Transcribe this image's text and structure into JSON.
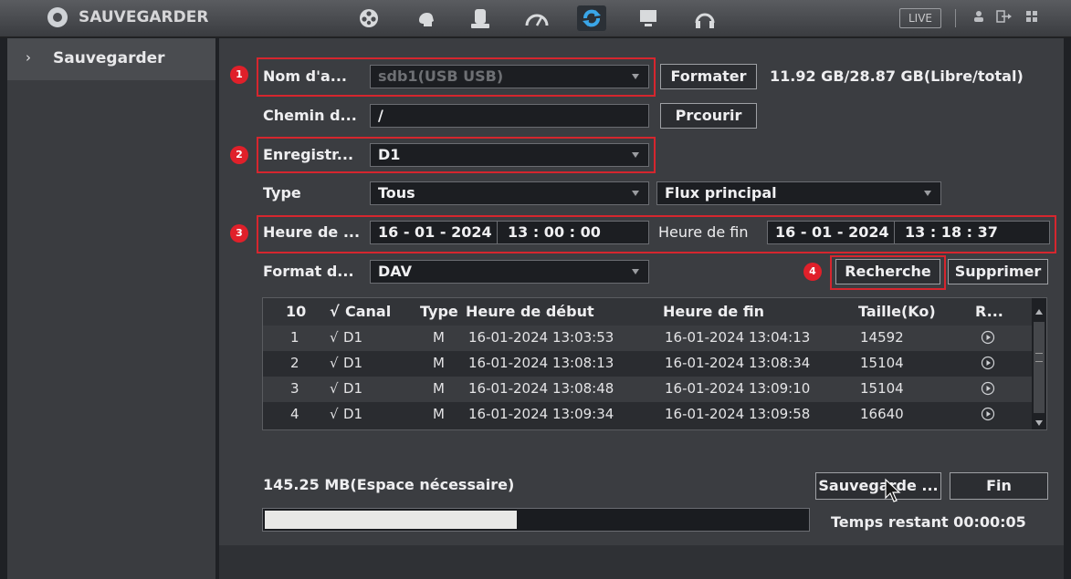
{
  "header": {
    "title": "SAUVEGARDER",
    "live_label": "LIVE",
    "menu_icons": [
      "film-reel-icon",
      "head-icon",
      "storage-icon",
      "gauge-icon",
      "backup-icon",
      "monitor-icon",
      "headphones-icon"
    ],
    "active_icon": "backup-icon"
  },
  "sidebar": {
    "items": [
      {
        "label": "Sauvegarder",
        "arrow": "›"
      }
    ]
  },
  "form": {
    "device_name": {
      "label": "Nom d'a...",
      "value": "sdb1(USB USB)"
    },
    "format_label": "Formater",
    "capacity": "11.92 GB/28.87 GB(Libre/total)",
    "path": {
      "label": "Chemin d...",
      "value": "/"
    },
    "browse_label": "Prcourir",
    "recorder": {
      "label": "Enregistr...",
      "value": "D1"
    },
    "type": {
      "label": "Type",
      "value": "Tous",
      "stream": "Flux principal"
    },
    "start_time": {
      "label": "Heure de ...",
      "date": "16 - 01 - 2024",
      "time": "13 : 00 : 00"
    },
    "end_time": {
      "label": "Heure de fin",
      "date": "16 - 01 - 2024",
      "time": "13 : 18 : 37"
    },
    "file_format": {
      "label": "Format d...",
      "value": "DAV"
    },
    "search_label": "Recherche",
    "delete_label": "Supprimer"
  },
  "annotations": [
    "1",
    "2",
    "3",
    "4"
  ],
  "table": {
    "count": "10",
    "columns": [
      "Canal",
      "Type",
      "Heure de début",
      "Heure de fin",
      "Taille(Ko)",
      "R..."
    ],
    "check": "√",
    "rows": [
      {
        "n": "1",
        "canal": "D1",
        "type": "M",
        "start": "16-01-2024 13:03:53",
        "end": "16-01-2024 13:04:13",
        "size": "14592"
      },
      {
        "n": "2",
        "canal": "D1",
        "type": "M",
        "start": "16-01-2024 13:08:13",
        "end": "16-01-2024 13:08:34",
        "size": "15104"
      },
      {
        "n": "3",
        "canal": "D1",
        "type": "M",
        "start": "16-01-2024 13:08:48",
        "end": "16-01-2024 13:09:10",
        "size": "15104"
      },
      {
        "n": "4",
        "canal": "D1",
        "type": "M",
        "start": "16-01-2024 13:09:34",
        "end": "16-01-2024 13:09:58",
        "size": "16640"
      }
    ]
  },
  "footer": {
    "space_needed": "145.25 MB(Espace nécessaire)",
    "backup_label": "Sauvegarde ...",
    "end_label": "Fin",
    "progress_fraction": 0.465,
    "remaining": "Temps restant 00:00:05"
  },
  "colors": {
    "annotation_red": "#d6262e",
    "accent_blue": "#3aa6e8"
  }
}
